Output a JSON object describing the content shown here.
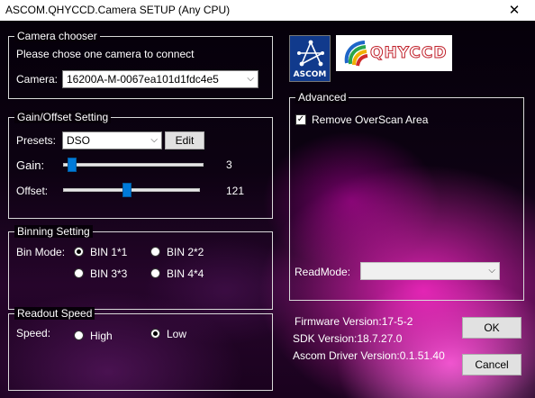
{
  "window": {
    "title": "ASCOM.QHYCCD.Camera SETUP (Any CPU)",
    "close_glyph": "✕"
  },
  "camera_chooser": {
    "legend": "Camera chooser",
    "hint": "Please chose one camera to connect",
    "camera_label": "Camera:",
    "camera_value": "16200A-M-0067ea101d1fdc4e5"
  },
  "gain_offset": {
    "legend": "Gain/Offset Setting",
    "presets_label": "Presets:",
    "presets_value": "DSO",
    "edit_label": "Edit",
    "gain_label": "Gain:",
    "gain_value": "3",
    "offset_label": "Offset:",
    "offset_value": "121",
    "gain_level": 0.07,
    "offset_level": 0.47
  },
  "binning": {
    "legend": "Binning Setting",
    "mode_label": "Bin Mode:",
    "options": [
      "BIN 1*1",
      "BIN 2*2",
      "BIN 3*3",
      "BIN 4*4"
    ],
    "selected": "BIN 1*1"
  },
  "readout_speed": {
    "legend": "Readout Speed",
    "speed_label": "Speed:",
    "options": [
      "High",
      "Low"
    ],
    "selected": "Low"
  },
  "logos": {
    "ascom_text": "ASCOM",
    "qhy_text": "QHYCCD"
  },
  "advanced": {
    "legend": "Advanced",
    "overscan_label": "Remove OverScan Area",
    "overscan_checked": true,
    "readmode_label": "ReadMode:",
    "readmode_value": ""
  },
  "versions": {
    "firmware": "Firmware Version:17-5-2",
    "sdk": "SDK Version:18.7.27.0",
    "driver": "Ascom Driver Version:0.1.51.40"
  },
  "buttons": {
    "ok": "OK",
    "cancel": "Cancel"
  },
  "colors": {
    "slider_thumb": "#007ad9",
    "ascom_blue": "#113a8c",
    "qhy_red": "#c0202a"
  }
}
